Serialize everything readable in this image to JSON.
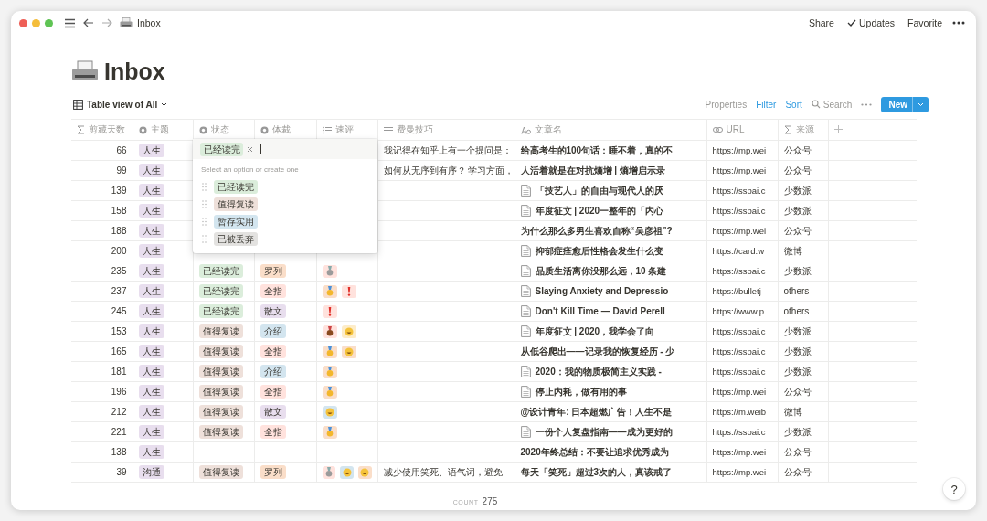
{
  "window": {
    "title": "Inbox",
    "actions": [
      {
        "label": "Share",
        "kind": "plain"
      },
      {
        "label": "Updates",
        "kind": "check"
      },
      {
        "label": "Favorite",
        "kind": "plain"
      }
    ]
  },
  "page": {
    "title": "Inbox"
  },
  "view": {
    "name": "Table view of All",
    "tools": [
      {
        "label": "Properties",
        "active": false,
        "kind": "plain"
      },
      {
        "label": "Filter",
        "active": true,
        "kind": "plain"
      },
      {
        "label": "Sort",
        "active": true,
        "kind": "plain"
      },
      {
        "label": "Search",
        "active": false,
        "kind": "search"
      }
    ],
    "new_button": "New"
  },
  "table": {
    "columns": [
      {
        "label": "剪藏天数",
        "kind": "formula"
      },
      {
        "label": "主题",
        "kind": "select"
      },
      {
        "label": "状态",
        "kind": "select"
      },
      {
        "label": "体裁",
        "kind": "select"
      },
      {
        "label": "速评",
        "kind": "multi"
      },
      {
        "label": "费曼技巧",
        "kind": "text"
      },
      {
        "label": "文章名",
        "kind": "title"
      },
      {
        "label": "URL",
        "kind": "url"
      },
      {
        "label": "来源",
        "kind": "formula"
      }
    ],
    "rows": [
      {
        "days": "66",
        "topic": {
          "text": "人生",
          "color": "#e8deee"
        },
        "rating": [],
        "note": "我记得在知乎上有一个提问是：",
        "article": {
          "text": "给高考生的100句话：睡不着，真的不",
          "doc": false
        },
        "url": "https://mp.wei",
        "source": "公众号"
      },
      {
        "days": "99",
        "topic": {
          "text": "人生",
          "color": "#e8deee"
        },
        "rating": [],
        "note": "如何从无序到有序？ 学习方面，",
        "article": {
          "text": "人活着就是在对抗熵增 | 熵增启示录",
          "doc": false
        },
        "url": "https://mp.wei",
        "source": "公众号"
      },
      {
        "days": "139",
        "topic": {
          "text": "人生",
          "color": "#e8deee"
        },
        "rating": [],
        "article": {
          "text": "「技艺人」的自由与现代人的厌",
          "doc": true
        },
        "url": "https://sspai.c",
        "source": "少数派"
      },
      {
        "days": "158",
        "topic": {
          "text": "人生",
          "color": "#e8deee"
        },
        "rating": [],
        "article": {
          "text": "年度征文 | 2020一整年的「内心",
          "doc": true
        },
        "url": "https://sspai.c",
        "source": "少数派"
      },
      {
        "days": "188",
        "topic": {
          "text": "人生",
          "color": "#e8deee"
        },
        "rating": [],
        "article": {
          "text": "为什么那么多男生喜欢自称“吴彦祖”?",
          "doc": false
        },
        "url": "https://mp.wei",
        "source": "公众号"
      },
      {
        "days": "200",
        "topic": {
          "text": "人生",
          "color": "#e8deee"
        },
        "rating": [],
        "article": {
          "text": "抑郁症痊愈后性格会发生什么变",
          "doc": true
        },
        "url": "https://card.w",
        "source": "微博"
      },
      {
        "days": "235",
        "topic": {
          "text": "人生",
          "color": "#e8deee"
        },
        "status": {
          "text": "已经读完",
          "color": "#dbeddb"
        },
        "genre": {
          "text": "罗列",
          "color": "#fadec9"
        },
        "rating": [
          {
            "kind": "silver",
            "color": "#ffe2dd"
          }
        ],
        "article": {
          "text": "品质生活离你没那么远，10 条建",
          "doc": true
        },
        "url": "https://sspai.c",
        "source": "少数派"
      },
      {
        "days": "237",
        "topic": {
          "text": "人生",
          "color": "#e8deee"
        },
        "status": {
          "text": "已经读完",
          "color": "#dbeddb"
        },
        "genre": {
          "text": "全指",
          "color": "#ffe2dd"
        },
        "rating": [
          {
            "kind": "gold",
            "color": "#fadec9"
          },
          {
            "kind": "alert",
            "color": "#ffe2dd"
          }
        ],
        "article": {
          "text": "Slaying Anxiety and Depressio",
          "doc": true
        },
        "url": "https://bulletj",
        "source": "others"
      },
      {
        "days": "245",
        "topic": {
          "text": "人生",
          "color": "#e8deee"
        },
        "status": {
          "text": "已经读完",
          "color": "#dbeddb"
        },
        "genre": {
          "text": "散文",
          "color": "#e8deee"
        },
        "rating": [
          {
            "kind": "alert",
            "color": "#ffe2dd"
          }
        ],
        "article": {
          "text": "Don't Kill Time — David Perell",
          "doc": true
        },
        "url": "https://www.p",
        "source": "others"
      },
      {
        "days": "153",
        "topic": {
          "text": "人生",
          "color": "#e8deee"
        },
        "status": {
          "text": "值得复读",
          "color": "#eee0da"
        },
        "genre": {
          "text": "介绍",
          "color": "#d3e5ef"
        },
        "rating": [
          {
            "kind": "bronze",
            "color": "#ffe2dd"
          },
          {
            "kind": "smiley",
            "color": "#fdecc8"
          }
        ],
        "article": {
          "text": "年度征文 | 2020，我学会了向",
          "doc": true
        },
        "url": "https://sspai.c",
        "source": "少数派"
      },
      {
        "days": "165",
        "topic": {
          "text": "人生",
          "color": "#e8deee"
        },
        "status": {
          "text": "值得复读",
          "color": "#eee0da"
        },
        "genre": {
          "text": "全指",
          "color": "#ffe2dd"
        },
        "rating": [
          {
            "kind": "gold",
            "color": "#fadec9"
          },
          {
            "kind": "smiley",
            "color": "#fadec9"
          }
        ],
        "article": {
          "text": "从低谷爬出——记录我的恢复经历 - 少",
          "doc": false
        },
        "url": "https://sspai.c",
        "source": "少数派"
      },
      {
        "days": "181",
        "topic": {
          "text": "人生",
          "color": "#e8deee"
        },
        "status": {
          "text": "值得复读",
          "color": "#eee0da"
        },
        "genre": {
          "text": "介绍",
          "color": "#d3e5ef"
        },
        "rating": [
          {
            "kind": "gold",
            "color": "#fadec9"
          }
        ],
        "article": {
          "text": "2020：我的物质极简主义实践 -",
          "doc": true
        },
        "url": "https://sspai.c",
        "source": "少数派"
      },
      {
        "days": "196",
        "topic": {
          "text": "人生",
          "color": "#e8deee"
        },
        "status": {
          "text": "值得复读",
          "color": "#eee0da"
        },
        "genre": {
          "text": "全指",
          "color": "#ffe2dd"
        },
        "rating": [
          {
            "kind": "gold",
            "color": "#fadec9"
          }
        ],
        "article": {
          "text": "停止内耗，做有用的事",
          "doc": true
        },
        "url": "https://mp.wei",
        "source": "公众号"
      },
      {
        "days": "212",
        "topic": {
          "text": "人生",
          "color": "#e8deee"
        },
        "status": {
          "text": "值得复读",
          "color": "#eee0da"
        },
        "genre": {
          "text": "散文",
          "color": "#e8deee"
        },
        "rating": [
          {
            "kind": "smiley",
            "color": "#d3e5ef"
          }
        ],
        "article": {
          "text": "@设计青年: 日本超燃广告！人生不是",
          "doc": false
        },
        "url": "https://m.weib",
        "source": "微博"
      },
      {
        "days": "221",
        "topic": {
          "text": "人生",
          "color": "#e8deee"
        },
        "status": {
          "text": "值得复读",
          "color": "#eee0da"
        },
        "genre": {
          "text": "全指",
          "color": "#ffe2dd"
        },
        "rating": [
          {
            "kind": "gold",
            "color": "#fadec9"
          }
        ],
        "article": {
          "text": "一份个人复盘指南——成为更好的",
          "doc": true
        },
        "url": "https://sspai.c",
        "source": "少数派"
      },
      {
        "days": "138",
        "topic": {
          "text": "人生",
          "color": "#e8deee"
        },
        "rating": [],
        "article": {
          "text": "2020年终总结：不要让追求优秀成为",
          "doc": false
        },
        "url": "https://mp.wei",
        "source": "公众号"
      },
      {
        "days": "39",
        "topic": {
          "text": "沟通",
          "color": "#e8deee"
        },
        "status": {
          "text": "值得复读",
          "color": "#eee0da"
        },
        "genre": {
          "text": "罗列",
          "color": "#fadec9"
        },
        "rating": [
          {
            "kind": "silver",
            "color": "#ffe2dd"
          },
          {
            "kind": "smiley",
            "color": "#d3e5ef"
          },
          {
            "kind": "smiley",
            "color": "#fadec9"
          }
        ],
        "note": "减少使用笑死、语气词，避免",
        "article": {
          "text": "每天「笑死」超过3次的人，真该戒了",
          "doc": false
        },
        "url": "https://mp.wei",
        "source": "公众号"
      }
    ]
  },
  "dropdown": {
    "value": {
      "text": "已经读完",
      "color": "#dbeddb"
    },
    "hint": "Select an option or create one",
    "options": [
      {
        "text": "已经读完",
        "color": "#dbeddb"
      },
      {
        "text": "值得复读",
        "color": "#eee0da"
      },
      {
        "text": "暂存实用",
        "color": "#d3e5ef"
      },
      {
        "text": "已被丢弃",
        "color": "#e3e2e0"
      }
    ]
  },
  "footer": {
    "label": "COUNT",
    "value": "275"
  },
  "help": "?"
}
